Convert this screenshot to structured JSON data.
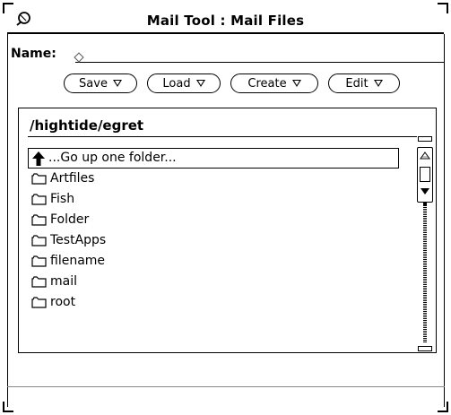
{
  "window": {
    "title": "Mail Tool : Mail Files"
  },
  "name_field": {
    "label": "Name:",
    "value": ""
  },
  "buttons": [
    {
      "label": "Save"
    },
    {
      "label": "Load"
    },
    {
      "label": "Create"
    },
    {
      "label": "Edit"
    }
  ],
  "file_list": {
    "path": "/hightide/egret",
    "up_item": "...Go up one folder...",
    "folders": [
      "Artfiles",
      "Fish",
      "Folder",
      "TestApps",
      "filename",
      "mail",
      "root"
    ]
  },
  "icons": {
    "window_menu": "window-menu-icon",
    "up": "up-arrow-icon",
    "folder": "folder-icon"
  }
}
